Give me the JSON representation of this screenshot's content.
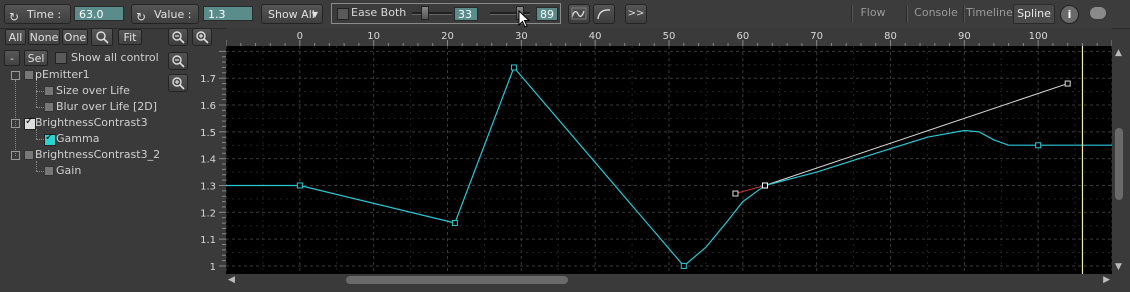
{
  "toolbar": {
    "time_label": "Time :",
    "time_value": "63.0",
    "value_label": "Value :",
    "value_value": "1.3",
    "show_all": "Show All",
    "ease_label": "Ease Both",
    "ease_left_value": "33",
    "ease_right_value": "89",
    "forward_label": ">>"
  },
  "tabs": [
    "Flow",
    "Console",
    "Timeline",
    "Spline"
  ],
  "active_tab": "Spline",
  "left_panel": {
    "buttons": {
      "all": "All",
      "none": "None",
      "one": "One",
      "fit": "Fit",
      "minus": "-",
      "sel": "Sel"
    },
    "show_all_control": "Show all control",
    "tree": [
      {
        "label": "pEmitter1",
        "level": 0,
        "checked": false
      },
      {
        "label": "Size over Life",
        "level": 1,
        "checked": false
      },
      {
        "label": "Blur over Life [2D]",
        "level": 1,
        "checked": false
      },
      {
        "label": "BrightnessContrast3",
        "level": 0,
        "checked": true
      },
      {
        "label": "Gamma",
        "level": 1,
        "checked": true
      },
      {
        "label": "BrightnessContrast3_2",
        "level": 0,
        "checked": false
      },
      {
        "label": "Gain",
        "level": 1,
        "checked": false
      }
    ]
  },
  "chart_data": {
    "type": "line",
    "x_ticks": [
      0,
      10,
      20,
      30,
      40,
      50,
      60,
      70,
      80,
      90,
      100
    ],
    "y_ticks": [
      1,
      1.1,
      1.2,
      1.3,
      1.4,
      1.5,
      1.6,
      1.7
    ],
    "xlim": [
      -10,
      110
    ],
    "ylim": [
      0.97,
      1.82
    ],
    "current_time": 106,
    "series": [
      {
        "color": "#28c8d4",
        "keyframes": [
          {
            "x": 0,
            "y": 1.3
          },
          {
            "x": 21,
            "y": 1.16
          },
          {
            "x": 29,
            "y": 1.74
          },
          {
            "x": 52,
            "y": 1.0
          },
          {
            "x": 63,
            "y": 1.3
          },
          {
            "x": 100,
            "y": 1.45
          }
        ],
        "curve": [
          [
            -10,
            1.3
          ],
          [
            0,
            1.3
          ],
          [
            21,
            1.16
          ],
          [
            29,
            1.74
          ],
          [
            52,
            1.0
          ],
          [
            55,
            1.07
          ],
          [
            58,
            1.17
          ],
          [
            60,
            1.24
          ],
          [
            62,
            1.28
          ],
          [
            63,
            1.3
          ],
          [
            70,
            1.35
          ],
          [
            78,
            1.42
          ],
          [
            85,
            1.48
          ],
          [
            90,
            1.505
          ],
          [
            92,
            1.5
          ],
          [
            94,
            1.47
          ],
          [
            96,
            1.45
          ],
          [
            100,
            1.45
          ],
          [
            110,
            1.45
          ]
        ],
        "selected_key": {
          "x": 63,
          "y": 1.3
        },
        "tangent_in": {
          "x": 59,
          "y": 1.27
        },
        "tangent_out": {
          "x": 104,
          "y": 1.68
        }
      }
    ]
  }
}
